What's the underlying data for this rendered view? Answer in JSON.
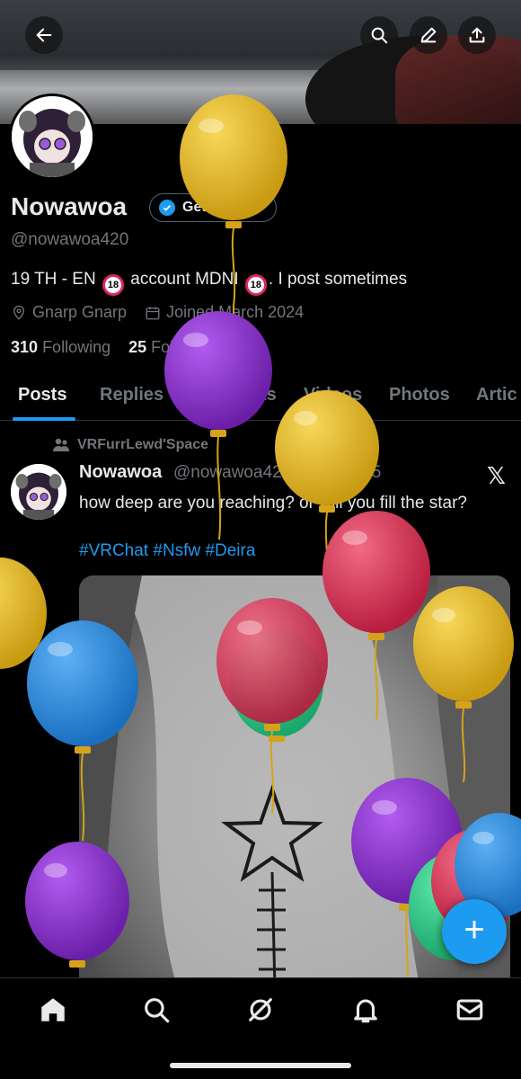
{
  "profile": {
    "name": "Nowawoa",
    "verified_label": "Get verified",
    "handle": "@nowawoa420",
    "bio_part1": "19 TH - EN",
    "bio_part2": "account MDNI",
    "bio_part3": ". I post sometimes",
    "mdni_badge": "18",
    "location": "Gnarp Gnarp",
    "joined": "Joined March 2024",
    "following_count": "310",
    "following_label": "Following",
    "followers_count": "25",
    "followers_label": "Followers"
  },
  "tabs": [
    "Posts",
    "Replies",
    "Highlights",
    "Videos",
    "Photos",
    "Artic"
  ],
  "post": {
    "repost_by": "VRFurrLewd'Space",
    "author": "Nowawoa",
    "meta": "@nowawoa420 · 7.11.2025",
    "text": "how deep are you reaching? or will you fill the star?",
    "hashtags": "#VRChat #Nsfw #Deira"
  },
  "icons": {
    "back": "back-arrow-icon",
    "search": "search-icon",
    "edit": "edit-icon",
    "share": "share-icon",
    "x": "x-logo-icon",
    "compose": "plus-icon"
  },
  "colors": {
    "accent": "#1d9bf0",
    "balloon_yellow": "#e8b823",
    "balloon_purple": "#8e2fd0",
    "balloon_red": "#e23a5a",
    "balloon_blue": "#2f8ee3",
    "balloon_green": "#2fd08e"
  }
}
